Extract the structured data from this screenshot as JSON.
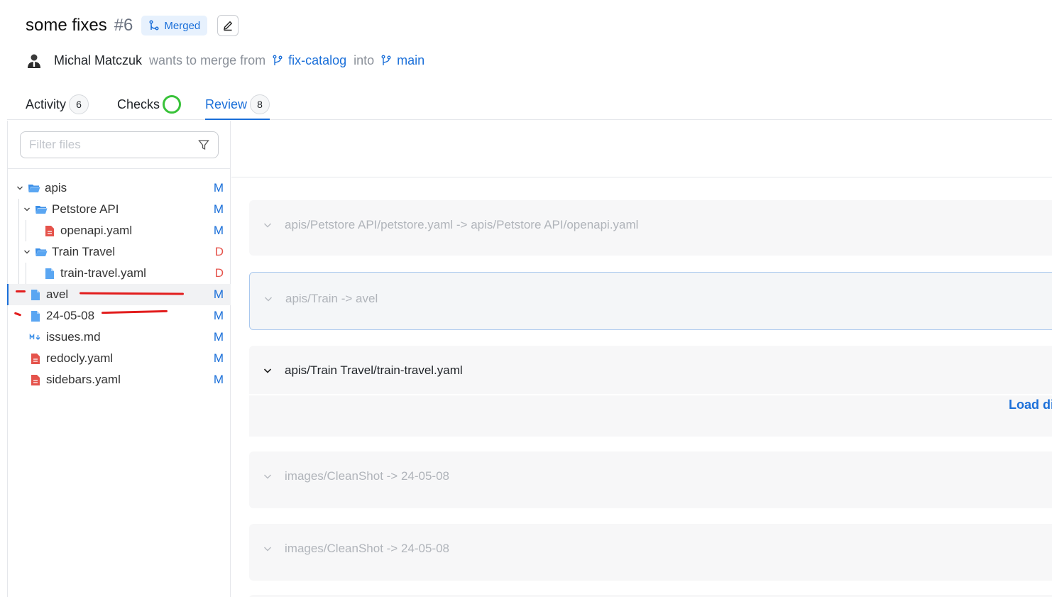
{
  "pr": {
    "title": "some fixes",
    "number": "#6",
    "status": "Merged",
    "author": "Michal Matczuk",
    "wants_text": "wants to merge from",
    "source_branch": "fix-catalog",
    "into_text": "into",
    "target_branch": "main"
  },
  "tabs": [
    {
      "label": "Activity",
      "count": "6"
    },
    {
      "label": "Checks",
      "count": ""
    },
    {
      "label": "Review",
      "count": "8"
    }
  ],
  "filter": {
    "placeholder": "Filter files"
  },
  "tree": [
    {
      "label": "apis",
      "status": "M"
    },
    {
      "label": "Petstore API",
      "status": "M"
    },
    {
      "label": "openapi.yaml",
      "status": "M"
    },
    {
      "label": "Train Travel",
      "status": "D"
    },
    {
      "label": "train-travel.yaml",
      "status": "D"
    },
    {
      "label": "avel",
      "status": "M"
    },
    {
      "label": "24-05-08",
      "status": "M"
    },
    {
      "label": "issues.md",
      "status": "M"
    },
    {
      "label": "redocly.yaml",
      "status": "M"
    },
    {
      "label": "sidebars.yaml",
      "status": "M"
    }
  ],
  "diffs": [
    {
      "path": "apis/Petstore API/petstore.yaml -> apis/Petstore API/openapi.yaml"
    },
    {
      "path": "apis/Train -> avel"
    },
    {
      "path": "apis/Train Travel/train-travel.yaml",
      "action": "Load di"
    },
    {
      "path": "images/CleanShot -> 24-05-08"
    },
    {
      "path": "images/CleanShot -> 24-05-08"
    }
  ],
  "colors": {
    "accent": "#1a6fd9",
    "deleted": "#e5534b",
    "check": "#38c239",
    "annotation": "#e21d1d"
  }
}
